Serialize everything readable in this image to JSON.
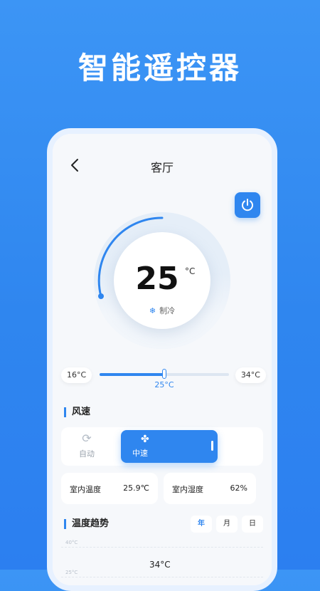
{
  "headline": "智能遥控器",
  "nav": {
    "title": "客厅"
  },
  "temperature": {
    "value": "25",
    "unit": "°C",
    "mode": "制冷",
    "mode_icon": "snowflake-icon"
  },
  "range": {
    "min": "16°C",
    "max": "34°C",
    "current": "25°C",
    "min_value": 16,
    "max_value": 34,
    "current_value": 25
  },
  "fan_speed": {
    "title": "风速",
    "options": [
      {
        "label": "自动",
        "icon": "refresh-icon",
        "active": false
      },
      {
        "label": "中速",
        "icon": "fan-icon",
        "active": true
      }
    ]
  },
  "indoor": {
    "temp_label": "室内温度",
    "temp_value": "25.9℃",
    "humidity_label": "室内湿度",
    "humidity_value": "62%"
  },
  "trend": {
    "title": "温度趋势",
    "tabs": [
      "年",
      "月",
      "日"
    ],
    "active_tab": "年",
    "y_ticks": [
      "40°C",
      "25°C"
    ],
    "point_label": "34°C"
  },
  "colors": {
    "accent": "#2f86ef",
    "background": "#3c95f5"
  }
}
